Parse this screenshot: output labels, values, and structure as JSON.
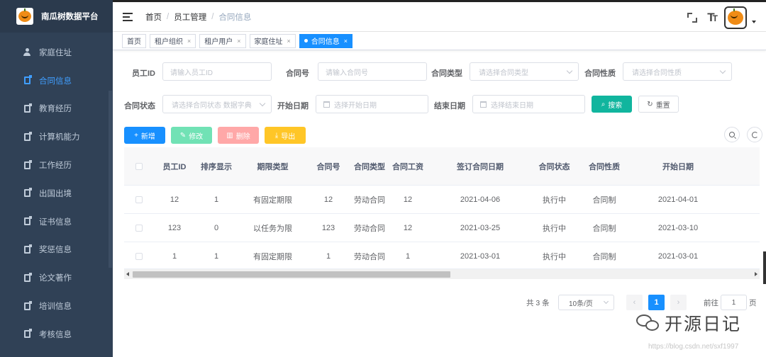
{
  "app": {
    "title": "南瓜树数据平台"
  },
  "sidebar": {
    "items": [
      {
        "label": "家庭住址",
        "icon": "user-icon",
        "active": false
      },
      {
        "label": "合同信息",
        "icon": "document-icon",
        "active": true
      },
      {
        "label": "教育经历",
        "icon": "document-icon",
        "active": false
      },
      {
        "label": "计算机能力",
        "icon": "document-icon",
        "active": false
      },
      {
        "label": "工作经历",
        "icon": "document-icon",
        "active": false
      },
      {
        "label": "出国出境",
        "icon": "document-icon",
        "active": false
      },
      {
        "label": "证书信息",
        "icon": "document-icon",
        "active": false
      },
      {
        "label": "奖惩信息",
        "icon": "document-icon",
        "active": false
      },
      {
        "label": "论文著作",
        "icon": "document-icon",
        "active": false
      },
      {
        "label": "培训信息",
        "icon": "document-icon",
        "active": false
      },
      {
        "label": "考核信息",
        "icon": "document-icon",
        "active": false
      }
    ]
  },
  "breadcrumb": {
    "home": "首页",
    "section": "员工管理",
    "current": "合同信息",
    "separator": "/"
  },
  "topbar": {
    "size_icon_text": "T",
    "size_icon_small": "T"
  },
  "tags": [
    {
      "label": "首页",
      "closable": false,
      "active": false
    },
    {
      "label": "租户组织",
      "closable": true,
      "active": false
    },
    {
      "label": "租户用户",
      "closable": true,
      "active": false
    },
    {
      "label": "家庭住址",
      "closable": true,
      "active": false
    },
    {
      "label": "合同信息",
      "closable": true,
      "active": true
    }
  ],
  "tag_close": "×",
  "search": {
    "employee_id": {
      "label": "员工ID",
      "placeholder": "请输入员工ID"
    },
    "contract_no": {
      "label": "合同号",
      "placeholder": "请输入合同号"
    },
    "contract_type": {
      "label": "合同类型",
      "placeholder": "请选择合同类型"
    },
    "contract_nature": {
      "label": "合同性质",
      "placeholder": "请选择合同性质"
    },
    "contract_status": {
      "label": "合同状态",
      "placeholder": "请选择合同状态 数据字典"
    },
    "start_date": {
      "label": "开始日期",
      "placeholder": "选择开始日期"
    },
    "end_date": {
      "label": "结束日期",
      "placeholder": "选择结束日期"
    },
    "search_button": "搜索",
    "reset_button": "重置"
  },
  "toolbar": {
    "add": "新增",
    "edit": "修改",
    "delete": "删除",
    "export": "导出"
  },
  "colors": {
    "primary": "#1890ff",
    "sidebar_bg": "#304156",
    "active_menu": "#409eff",
    "search_btn": "#11b59e",
    "edit_btn": "#71e2b5",
    "delete_btn": "#ffa8a8",
    "export_btn": "#ffc627"
  },
  "table": {
    "columns": [
      "员工ID",
      "排序显示",
      "期限类型",
      "合同号",
      "合同类型",
      "合同工资",
      "签订合同日期",
      "合同状态",
      "合同性质",
      "开始日期"
    ],
    "rows": [
      [
        "12",
        "1",
        "有固定期限",
        "12",
        "劳动合同",
        "12",
        "2021-04-06",
        "执行中",
        "合同制",
        "2021-04-01"
      ],
      [
        "123",
        "0",
        "以任务为限",
        "123",
        "劳动合同",
        "12",
        "2021-03-25",
        "执行中",
        "合同制",
        "2021-03-10"
      ],
      [
        "1",
        "1",
        "有固定期限",
        "1",
        "劳动合同",
        "1",
        "2021-03-01",
        "执行中",
        "合同制",
        "2021-03-01"
      ]
    ]
  },
  "pagination": {
    "total_text": "共 3 条",
    "page_size": "10条/页",
    "prev": "‹",
    "next": "›",
    "current_page": "1",
    "goto_prefix": "前往",
    "goto_value": "1",
    "goto_suffix": "页"
  },
  "watermark": {
    "text": "开源日记",
    "url": "https://blog.csdn.net/sxf1997"
  }
}
